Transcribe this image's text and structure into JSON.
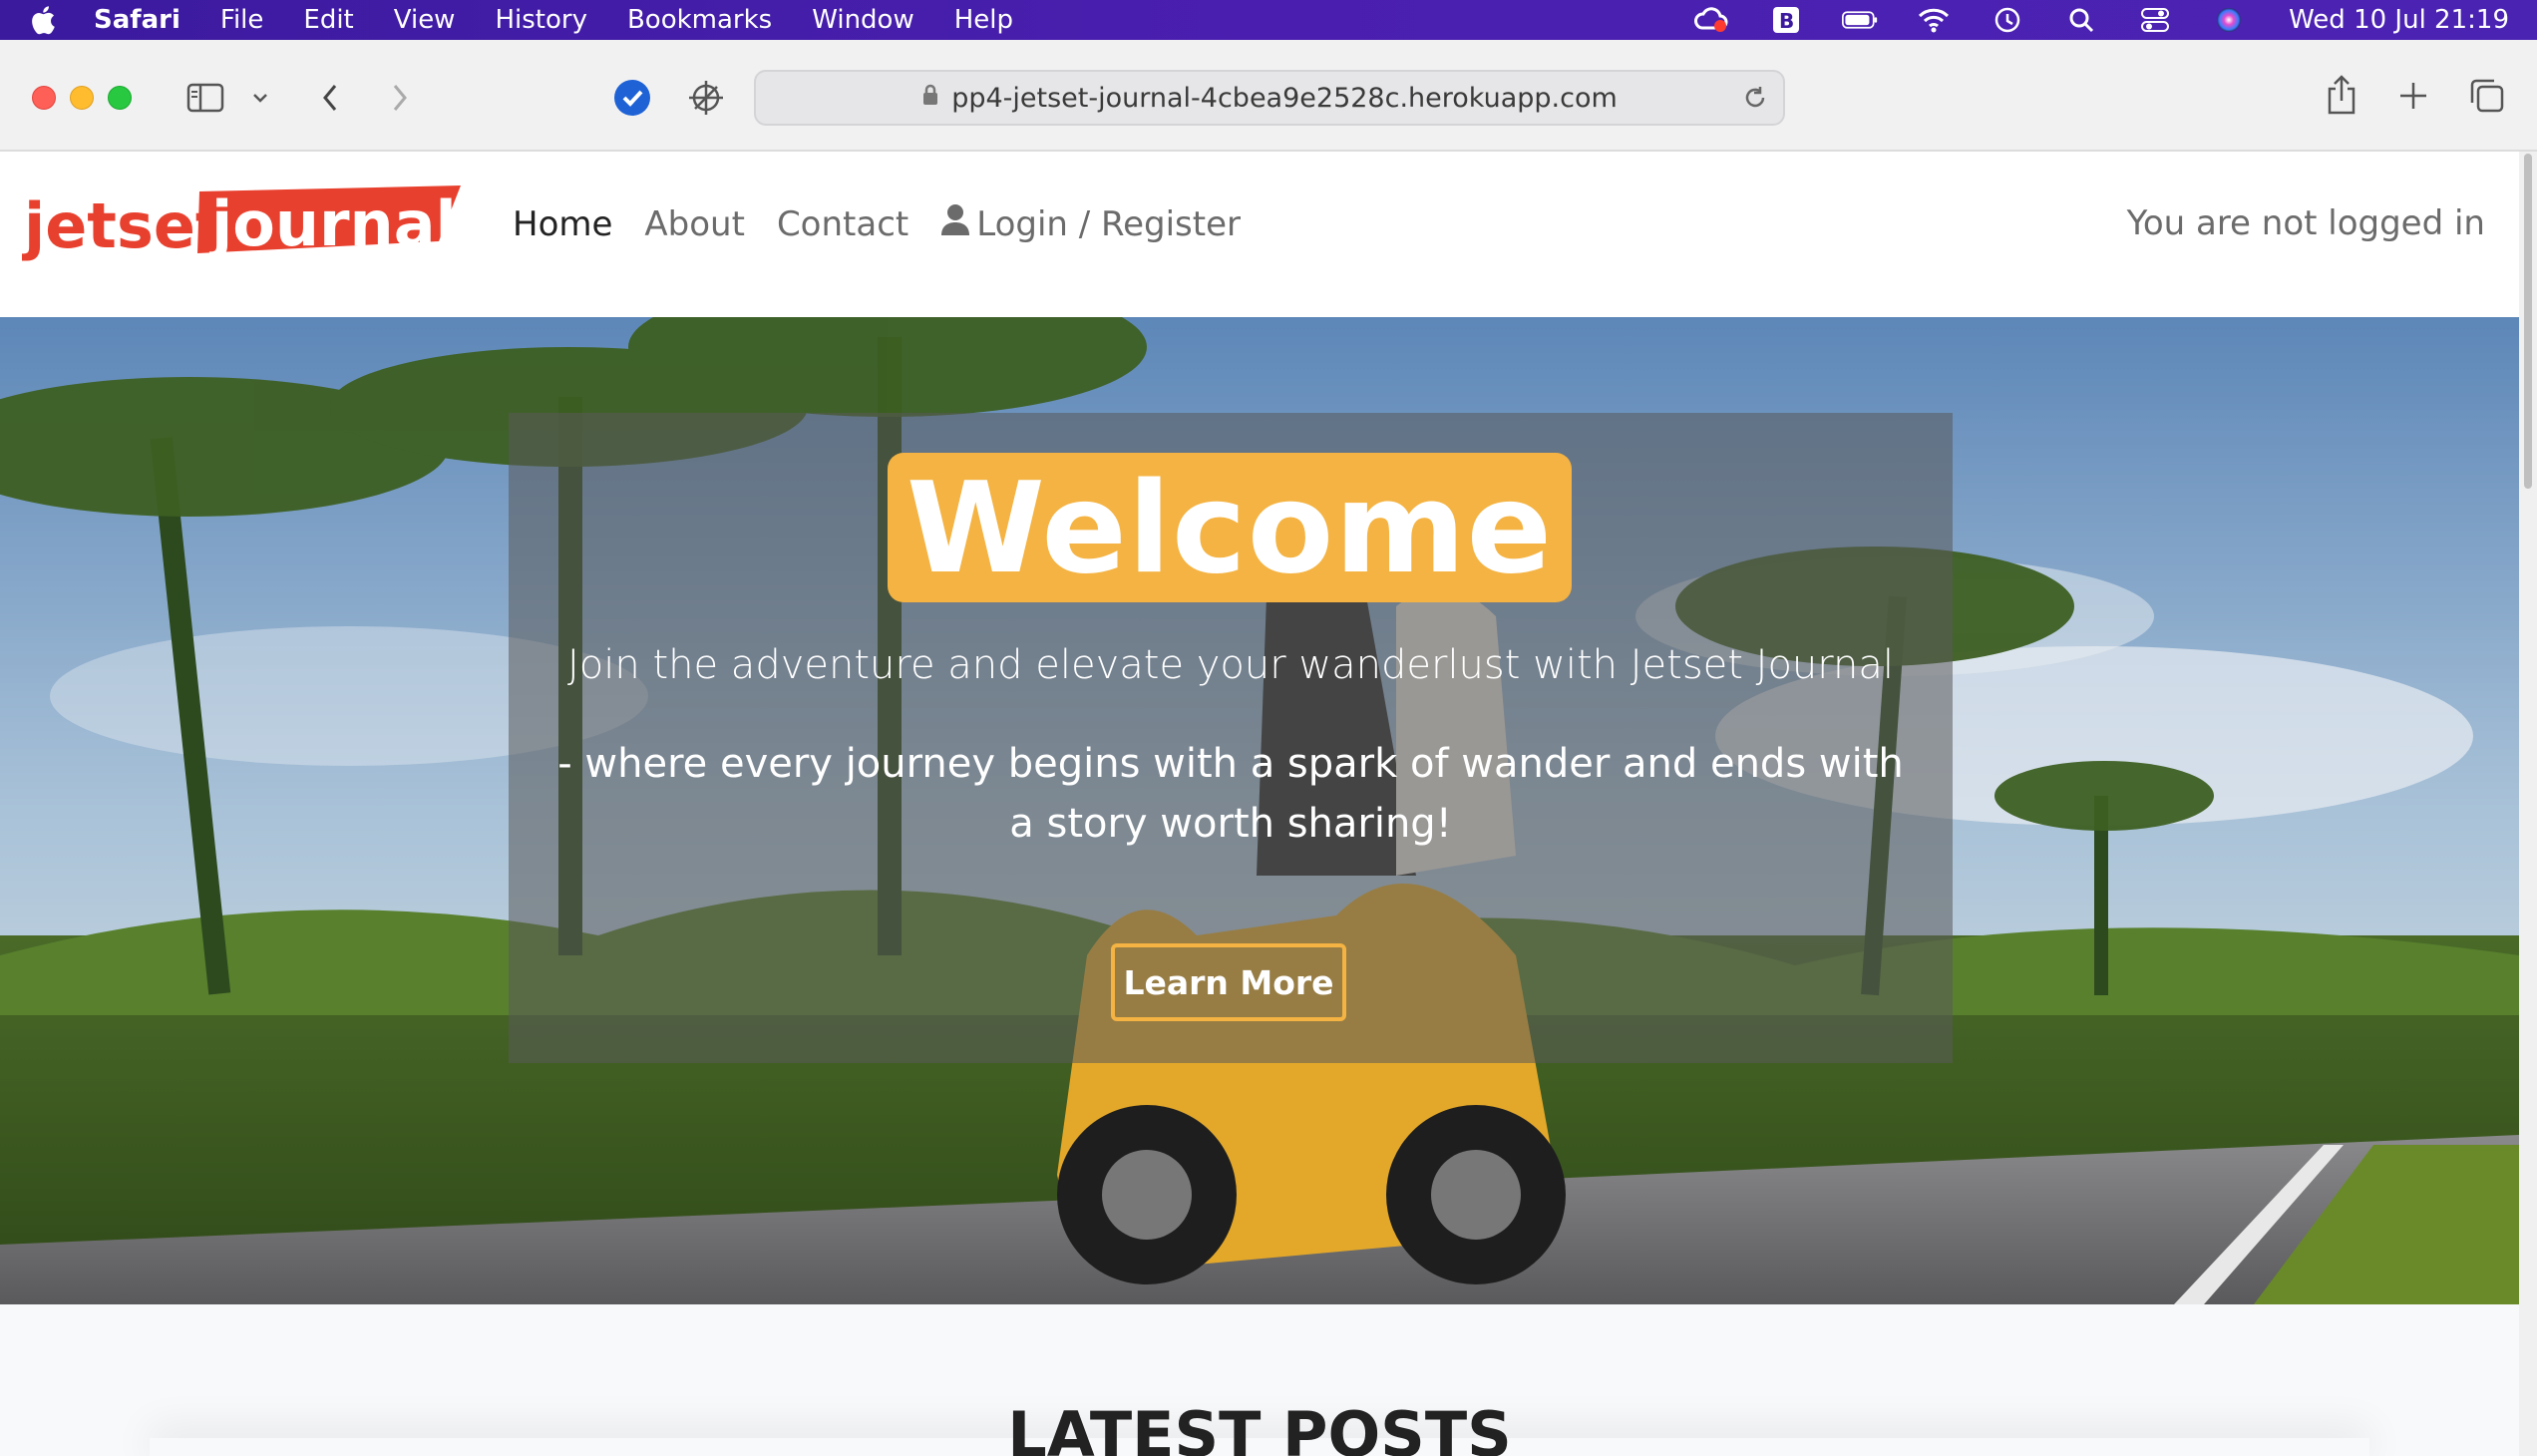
{
  "menubar": {
    "app": "Safari",
    "items": [
      "File",
      "Edit",
      "View",
      "History",
      "Bookmarks",
      "Window",
      "Help"
    ],
    "datetime": "Wed 10 Jul  21:19"
  },
  "browser": {
    "url": "pp4-jetset-journal-4cbea9e2528c.herokuapp.com"
  },
  "site": {
    "logo_text_1": "jetset",
    "logo_text_2": "journal",
    "nav": {
      "home": "Home",
      "about": "About",
      "contact": "Contact",
      "login": "Login / Register"
    },
    "status": "You are not logged in"
  },
  "hero": {
    "title": "Welcome",
    "tagline_1": "Join the adventure and elevate your wanderlust with Jetset Journal",
    "tagline_2": "- where every journey begins with a spark of wander and ends with a story worth sharing!",
    "button": "Learn More"
  },
  "section": {
    "latest_heading": "LATEST POSTS"
  },
  "colors": {
    "menubar": "#4a1fb0",
    "accent": "#f4b342",
    "logo_red": "#e8402e"
  }
}
